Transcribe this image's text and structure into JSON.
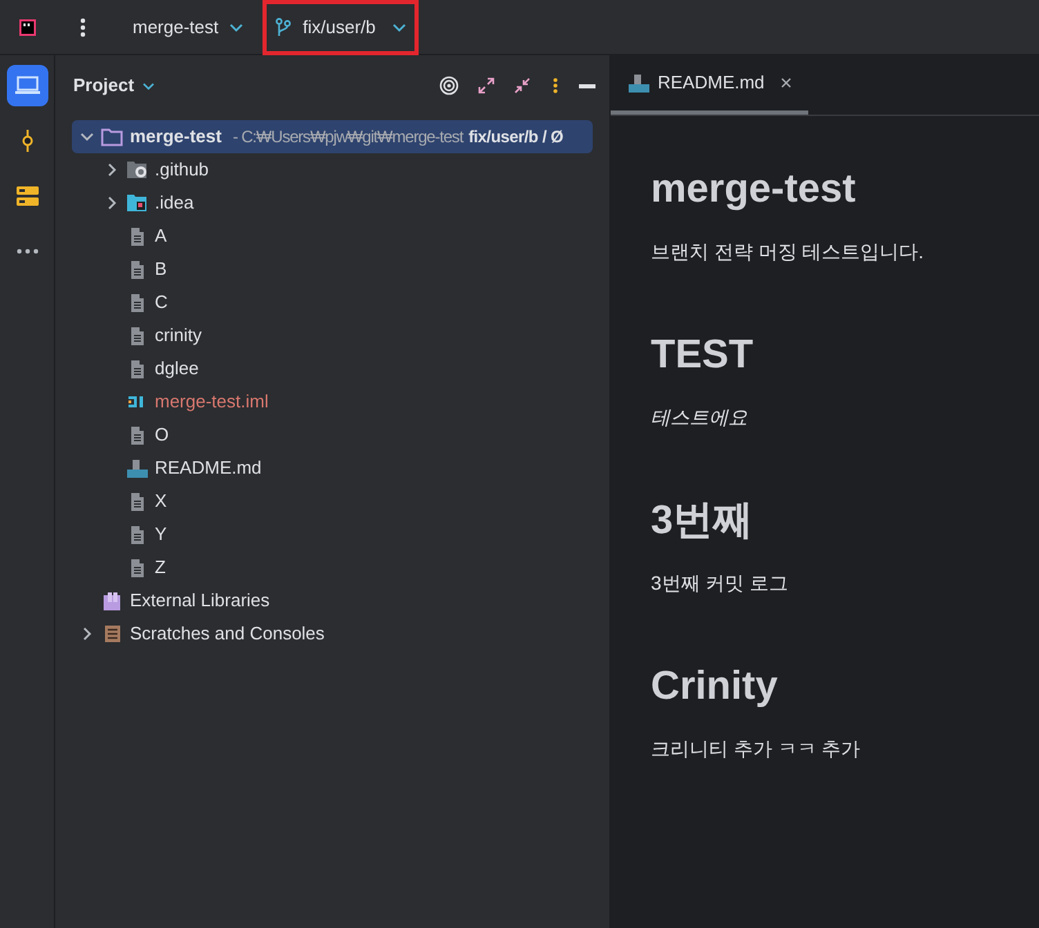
{
  "toolbar": {
    "project": "merge-test",
    "branch": {
      "label": "fix/user/b",
      "highlighted": true
    }
  },
  "sidebar": {
    "items": [
      {
        "kind": "project",
        "selected": true
      },
      {
        "kind": "commit",
        "selected": false
      },
      {
        "kind": "structure",
        "selected": false
      },
      {
        "kind": "more",
        "selected": false
      }
    ]
  },
  "project_panel": {
    "title": "Project",
    "tree": [
      {
        "kind": "folder",
        "name": "merge-test",
        "path": "- C:₩Users₩pjw₩git₩merge-test",
        "branch": "fix/user/b / Ø",
        "expanded": true,
        "selected": true,
        "children": [
          {
            "kind": "github",
            "name": ".github",
            "expanded": false,
            "selected": false
          },
          {
            "kind": "idea",
            "name": ".idea",
            "expanded": false,
            "selected": false
          },
          {
            "kind": "file",
            "name": "A",
            "selected": false
          },
          {
            "kind": "file",
            "name": "B",
            "selected": false
          },
          {
            "kind": "file",
            "name": "C",
            "selected": false
          },
          {
            "kind": "file",
            "name": "crinity",
            "selected": false
          },
          {
            "kind": "file",
            "name": "dglee",
            "selected": false
          },
          {
            "kind": "iml",
            "name": "merge-test.iml",
            "selected": false
          },
          {
            "kind": "file",
            "name": "O",
            "selected": false
          },
          {
            "kind": "md",
            "name": "README.md",
            "selected": false
          },
          {
            "kind": "file",
            "name": "X",
            "selected": false
          },
          {
            "kind": "file",
            "name": "Y",
            "selected": false
          },
          {
            "kind": "file",
            "name": "Z",
            "selected": false
          }
        ]
      },
      {
        "kind": "library",
        "name": "External Libraries",
        "selected": false
      },
      {
        "kind": "scratches",
        "name": "Scratches and Consoles",
        "expanded": false,
        "selected": false
      }
    ]
  },
  "editor": {
    "tabs": [
      {
        "label": "README.md",
        "selected": true
      }
    ],
    "content": [
      {
        "kind": "heading",
        "text": "merge-test"
      },
      {
        "kind": "paragraph",
        "text": "브랜치 전략 머징 테스트입니다."
      },
      {
        "kind": "heading",
        "text": "TEST"
      },
      {
        "kind": "italic",
        "text": "테스트에요"
      },
      {
        "kind": "heading",
        "text": "3번째"
      },
      {
        "kind": "paragraph",
        "text": "3번째 커밋 로그"
      },
      {
        "kind": "heading",
        "text": "Crinity"
      },
      {
        "kind": "paragraph",
        "text": "크리니티 추가 ㅋㅋ 추가"
      }
    ]
  }
}
